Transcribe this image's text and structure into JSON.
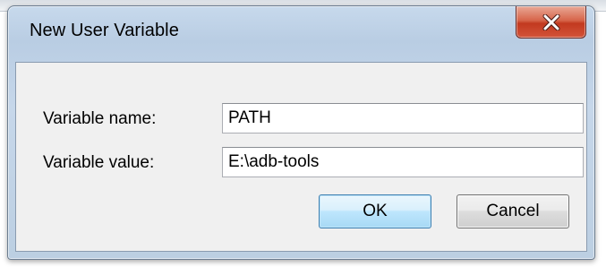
{
  "window": {
    "title": "New User Variable"
  },
  "form": {
    "name_label": "Variable name:",
    "name_value": "PATH",
    "value_label": "Variable value:",
    "value_value": "E:\\adb-tools"
  },
  "buttons": {
    "ok_label": "OK",
    "cancel_label": "Cancel"
  },
  "icons": {
    "close": "close-icon"
  },
  "colors": {
    "close_button": "#c7432a",
    "ok_button_border": "#3c7fb1",
    "client_bg": "#f0f0f0",
    "frame": "#bccfe2"
  }
}
